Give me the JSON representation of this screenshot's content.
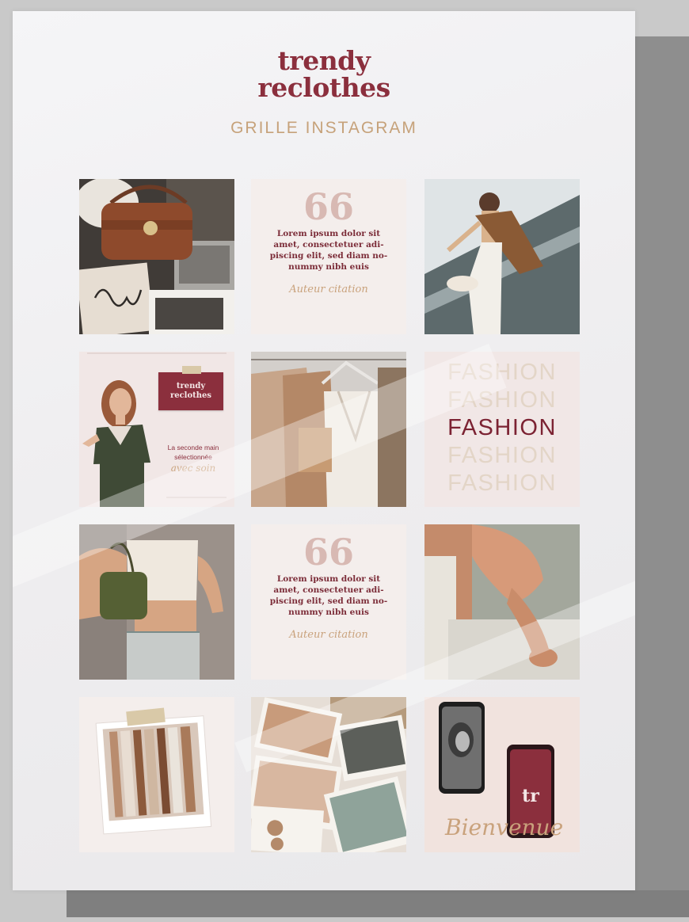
{
  "brand": {
    "line1": "trendy",
    "line2": "reclothes",
    "subtitle": "GRILLE INSTAGRAM"
  },
  "quote_tile_1": {
    "mark": "66",
    "text": "Lorem ipsum dolor sit amet, consectetuer adi-piscing elit, sed diam no-nummy nibh euis",
    "author": "Auteur citation"
  },
  "quote_tile_2": {
    "mark": "66",
    "text": "Lorem ipsum dolor sit amet, consectetuer adi-piscing elit, sed diam no-nummy nibh euis",
    "author": "Auteur citation"
  },
  "intro_tile": {
    "badge_line1": "trendy",
    "badge_line2": "reclothes",
    "tagline_line1": "La seconde main",
    "tagline_line2": "sélectionnée",
    "tagline_script": "avec soin"
  },
  "fashion_tile": {
    "words": [
      "FASHION",
      "FASHION",
      "FASHION",
      "FASHION",
      "FASHION"
    ],
    "highlight_index": 2
  },
  "welcome_tile": {
    "script": "Bienvenue"
  },
  "colors": {
    "brand": "#8b2f3d",
    "gold": "#c6a27a",
    "cream": "#f4eeec",
    "blush": "#e6d3cc"
  },
  "icons": [
    "quote-icon",
    "phone-icon",
    "logo-monogram-icon"
  ]
}
